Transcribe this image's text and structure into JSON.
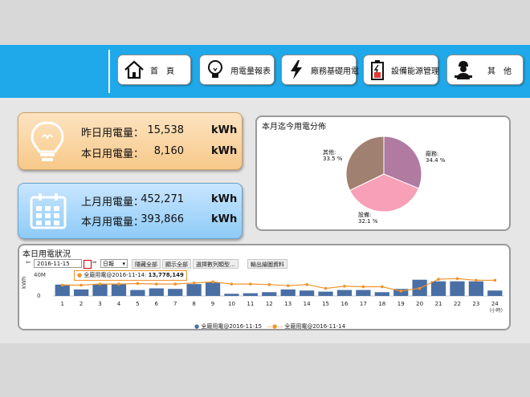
{
  "nav": [
    {
      "label": "首　頁",
      "icon": "home-icon"
    },
    {
      "label": "用電量報表",
      "icon": "lightbulb-icon"
    },
    {
      "label": "廠務基礎用電",
      "icon": "lightning-icon"
    },
    {
      "label": "設備能源管理",
      "icon": "battery-icon"
    },
    {
      "label": "其　他",
      "icon": "engineer-icon"
    }
  ],
  "stats": {
    "yesterday": {
      "label": "昨日用電量：",
      "value": "15,538",
      "unit": "kWh"
    },
    "today": {
      "label": "本日用電量：",
      "value": "8,160",
      "unit": "kWh"
    },
    "last_month": {
      "label": "上月用電量：",
      "value": "452,271",
      "unit": "kWh"
    },
    "this_month": {
      "label": "本月用電量：",
      "value": "393,866",
      "unit": "kWh"
    }
  },
  "pie": {
    "title": "本月迄今用電分佈",
    "labels": {
      "other": {
        "name": "其他:",
        "pct": "33.5 %"
      },
      "factory": {
        "name": "廠務:",
        "pct": "34.4 %"
      },
      "equipment": {
        "name": "設備:",
        "pct": "32.1 %"
      }
    }
  },
  "daily": {
    "title": "本日用電狀況",
    "date": "2016-11-15",
    "interval": "日報",
    "buttons": [
      "隱藏全部",
      "顯示全部",
      "選擇數列類型...",
      "輸出繪圖資料"
    ],
    "tooltip_label": "全廠用電@2016-11-14:",
    "tooltip_value": "13,778,149"
  },
  "chart_data": {
    "type": "bar",
    "categories": [
      "1",
      "2",
      "3",
      "4",
      "5",
      "6",
      "7",
      "8",
      "9",
      "10",
      "11",
      "12",
      "13",
      "14",
      "15",
      "16",
      "17",
      "18",
      "19",
      "20",
      "21",
      "22",
      "23",
      "24"
    ],
    "x_unit": "(小時)",
    "ylabel": "kWh",
    "y_tick_labels": [
      "40M",
      "0"
    ],
    "ylim": [
      0,
      40
    ],
    "series": [
      {
        "name": "全廠用電@2016-11-15",
        "type": "bar",
        "color": "#4a6fa5",
        "values": [
          21,
          12,
          22,
          22,
          11,
          14,
          13,
          22,
          25,
          4,
          5,
          7,
          12,
          10,
          8,
          11,
          11,
          7,
          13,
          30,
          27,
          27,
          27,
          10
        ]
      },
      {
        "name": "全廠用電@2016-11-14",
        "type": "line",
        "color": "#f0932b",
        "values": [
          20,
          20,
          22,
          22,
          23,
          22,
          22,
          24,
          26,
          22,
          22,
          21,
          19,
          21,
          14,
          18,
          17,
          17,
          9,
          14,
          31,
          32,
          29,
          29
        ]
      }
    ]
  },
  "colors": {
    "topbar": "#1fa9ea",
    "pie_other": "#a08070",
    "pie_factory": "#b07aa1",
    "pie_equipment": "#f7a0b8"
  }
}
